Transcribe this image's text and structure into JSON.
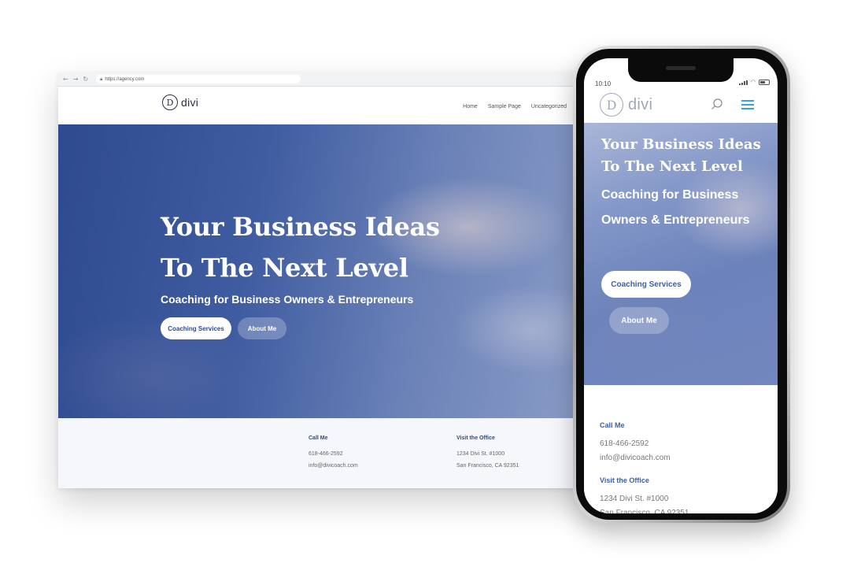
{
  "browser": {
    "url": "https://agency.com",
    "nav": {
      "back_icon": "arrow-left-icon",
      "forward_icon": "arrow-right-icon",
      "reload_icon": "reload-icon"
    }
  },
  "site": {
    "logo_letter": "D",
    "logo_text": "divi",
    "menu": [
      "Home",
      "Sample Page",
      "Uncategorized"
    ]
  },
  "hero": {
    "title_line1": "Your Business Ideas",
    "title_line2": "To The Next Level",
    "subtitle": "Coaching for Business Owners & Entrepreneurs",
    "primary_button": "Coaching Services",
    "secondary_button": "About Me"
  },
  "contact": {
    "call": {
      "heading": "Call Me",
      "phone": "618-466-2592",
      "email": "info@divicoach.com"
    },
    "visit": {
      "heading": "Visit the Office",
      "street": "1234 Divi St. #1000",
      "city": "San Francisco, CA 92351"
    }
  },
  "mobile": {
    "status_time": "10:10",
    "title_line1": "Your Business Ideas",
    "title_line2": "To The Next Level",
    "subtitle": "Coaching for Business Owners & Entrepreneurs"
  },
  "colors": {
    "accent": "#2e4a8c",
    "hamburger": "#3aa0e6"
  }
}
